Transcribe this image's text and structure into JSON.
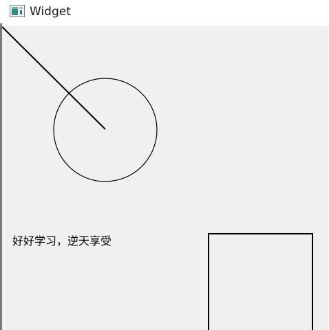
{
  "window": {
    "title": "Widget",
    "icon": "qt-window-icon"
  },
  "canvas": {
    "background_color": "#f0f0f0",
    "stroke_color": "#000000",
    "text": "好好学习，逆天享受"
  }
}
